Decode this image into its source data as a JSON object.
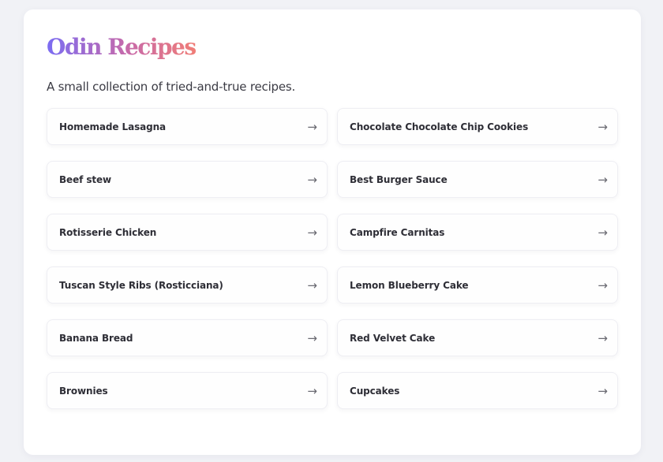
{
  "title": "Odin Recipes",
  "subtitle": "A small collection of tried-and-true recipes.",
  "recipes": [
    {
      "label": "Homemade Lasagna"
    },
    {
      "label": "Chocolate Chocolate Chip Cookies"
    },
    {
      "label": "Beef stew"
    },
    {
      "label": "Best Burger Sauce"
    },
    {
      "label": "Rotisserie Chicken"
    },
    {
      "label": "Campfire Carnitas"
    },
    {
      "label": "Tuscan Style Ribs (Rosticciana)"
    },
    {
      "label": "Lemon Blueberry Cake"
    },
    {
      "label": "Banana Bread"
    },
    {
      "label": "Red Velvet Cake"
    },
    {
      "label": "Brownies"
    },
    {
      "label": "Cupcakes"
    }
  ],
  "arrow_glyph": "→",
  "icons": {
    "arrow": "arrow-right-icon"
  },
  "colors": {
    "title_gradient": [
      "#7b6cf2",
      "#c86aa9",
      "#f07d77"
    ],
    "background": "#f1f2f6",
    "card": "#ffffff"
  }
}
